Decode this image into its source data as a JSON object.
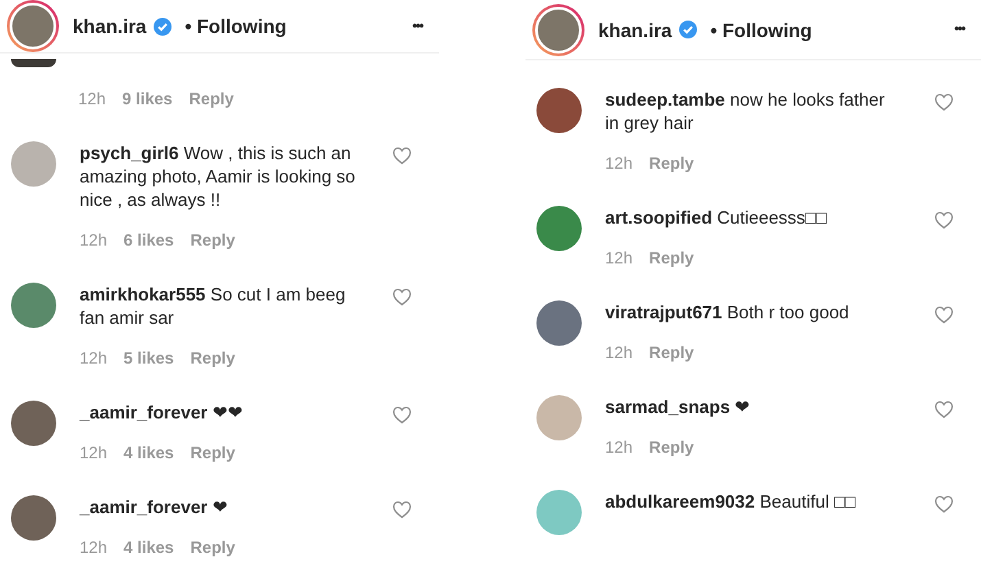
{
  "panels": [
    {
      "header": {
        "username": "khan.ira",
        "verified": true,
        "follow_status": "• Following",
        "more": "•••"
      },
      "comments": [
        {
          "kind": "continued",
          "time": "12h",
          "likes": "9 likes",
          "reply": "Reply"
        },
        {
          "kind": "comment",
          "user": "psych_girl6",
          "text": "Wow , this is such an amazing photo, Aamir is looking so nice , as always !!",
          "time": "12h",
          "likes": "6 likes",
          "reply": "Reply"
        },
        {
          "kind": "comment",
          "user": "amirkhokar555",
          "text": "So cut I am beeg fan amir sar",
          "time": "12h",
          "likes": "5 likes",
          "reply": "Reply"
        },
        {
          "kind": "comment",
          "user": "_aamir_forever",
          "text": "❤❤",
          "time": "12h",
          "likes": "4 likes",
          "reply": "Reply"
        },
        {
          "kind": "comment",
          "user": "_aamir_forever",
          "text": "❤",
          "time": "12h",
          "likes": "4 likes",
          "reply": "Reply"
        }
      ]
    },
    {
      "header": {
        "username": "khan.ira",
        "verified": true,
        "follow_status": "• Following",
        "more": "•••"
      },
      "comments": [
        {
          "kind": "comment",
          "user": "sudeep.tambe",
          "text": "now he looks father in grey hair",
          "time": "12h",
          "reply": "Reply"
        },
        {
          "kind": "comment",
          "user": "art.soopified",
          "text": "Cutieeesss□□",
          "time": "12h",
          "reply": "Reply"
        },
        {
          "kind": "comment",
          "user": "viratrajput671",
          "text": "Both r too good",
          "time": "12h",
          "reply": "Reply"
        },
        {
          "kind": "comment",
          "user": "sarmad_snaps",
          "text": "❤",
          "time": "12h",
          "reply": "Reply"
        },
        {
          "kind": "comment",
          "user": "abdulkareem9032",
          "text": "Beautiful □□"
        }
      ]
    }
  ]
}
